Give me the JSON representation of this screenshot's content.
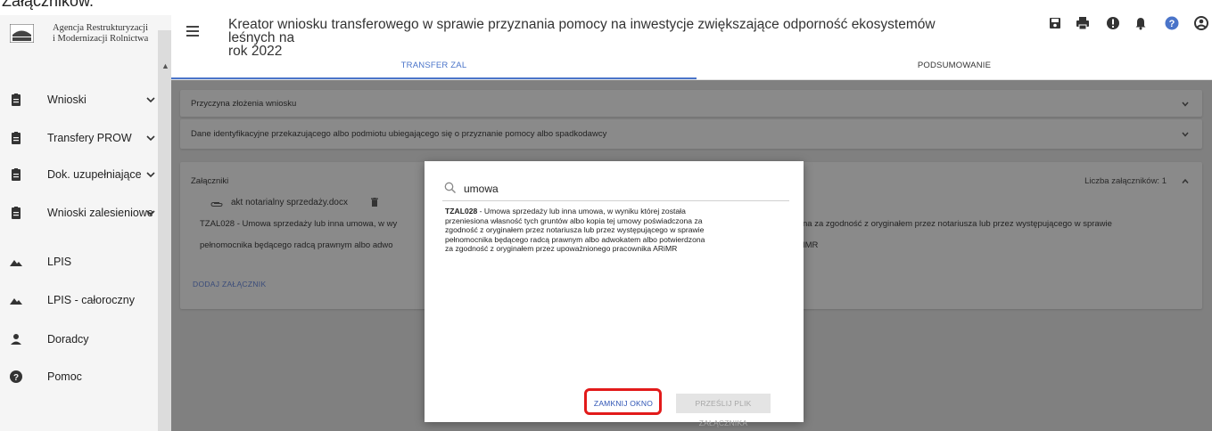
{
  "top_cut_text": "Załączników.",
  "sidebar": {
    "logo_line1": "Agencja Restrukturyzacji",
    "logo_line2": "i Modernizacji Rolnictwa",
    "items": [
      {
        "label": "Wnioski",
        "icon": "clipboard-icon",
        "chevron": true
      },
      {
        "label": "Transfery PROW",
        "icon": "clipboard-icon",
        "chevron": true
      },
      {
        "label": "Dok. uzupełniające",
        "icon": "clipboard-icon",
        "chevron": true
      },
      {
        "label": "Wnioski zalesieniowe",
        "icon": "clipboard-icon",
        "chevron": true
      },
      {
        "label": "LPIS",
        "icon": "mountains-icon",
        "chevron": false
      },
      {
        "label": "LPIS - całoroczny",
        "icon": "mountains-icon",
        "chevron": false
      },
      {
        "label": "Doradcy",
        "icon": "person-icon",
        "chevron": false
      },
      {
        "label": "Pomoc",
        "icon": "help-circle-icon",
        "chevron": false
      }
    ]
  },
  "header": {
    "title_line1": "Kreator wniosku transferowego w sprawie przyznania pomocy na inwestycje zwiększające odporność ekosystemów leśnych na",
    "title_line2": "rok 2022",
    "icons": [
      "save-icon",
      "print-icon",
      "alert-icon",
      "bell-icon",
      "help-icon",
      "account-icon"
    ],
    "tabs": [
      {
        "label": "TRANSFER ZAL",
        "active": true
      },
      {
        "label": "PODSUMOWANIE",
        "active": false
      }
    ]
  },
  "panels": {
    "reason": {
      "title": "Przyczyna złożenia wniosku"
    },
    "identity": {
      "title": "Dane identyfikacyjne przekazującego albo podmiotu ubiegającego się o przyznanie pomocy albo spadkodawcy"
    },
    "attachments": {
      "title": "Załączniki",
      "count_label": "Liczba załączników: 1",
      "file_name": "akt notarialny sprzedaży.docx",
      "desc_line1_left": "TZAL028 - Umowa sprzedaży lub inna umowa, w wy",
      "desc_line1_right": "na za zgodność z oryginałem przez notariusza lub przez występującego w sprawie",
      "desc_line2_left": "pełnomocnika będącego radcą prawnym albo adwo",
      "desc_line2_right": "IMR",
      "add_label": "DODAJ ZAŁĄCZNIK"
    }
  },
  "modal": {
    "search_value": "umowa",
    "code": "TZAL028",
    "text_line1": " - Umowa sprzedaży lub inna umowa, w wyniku której została",
    "text_line2": "przeniesiona własność tych gruntów albo kopia tej umowy poświadczona za",
    "text_line3": "zgodność z oryginałem przez notariusza lub przez występującego w sprawie",
    "text_line4": "pełnomocnika będącego radcą prawnym albo adwokatem albo potwierdzona",
    "text_line5": "za zgodność z oryginałem przez upoważnionego pracownika ARiMR",
    "close_label": "ZAMKNIJ OKNO",
    "send_label": "PRZEŚLIJ PLIK ZAŁĄCZNIKA"
  },
  "colors": {
    "accent": "#4a74c9",
    "highlight": "#e21a1a",
    "overlay": "#808080"
  }
}
